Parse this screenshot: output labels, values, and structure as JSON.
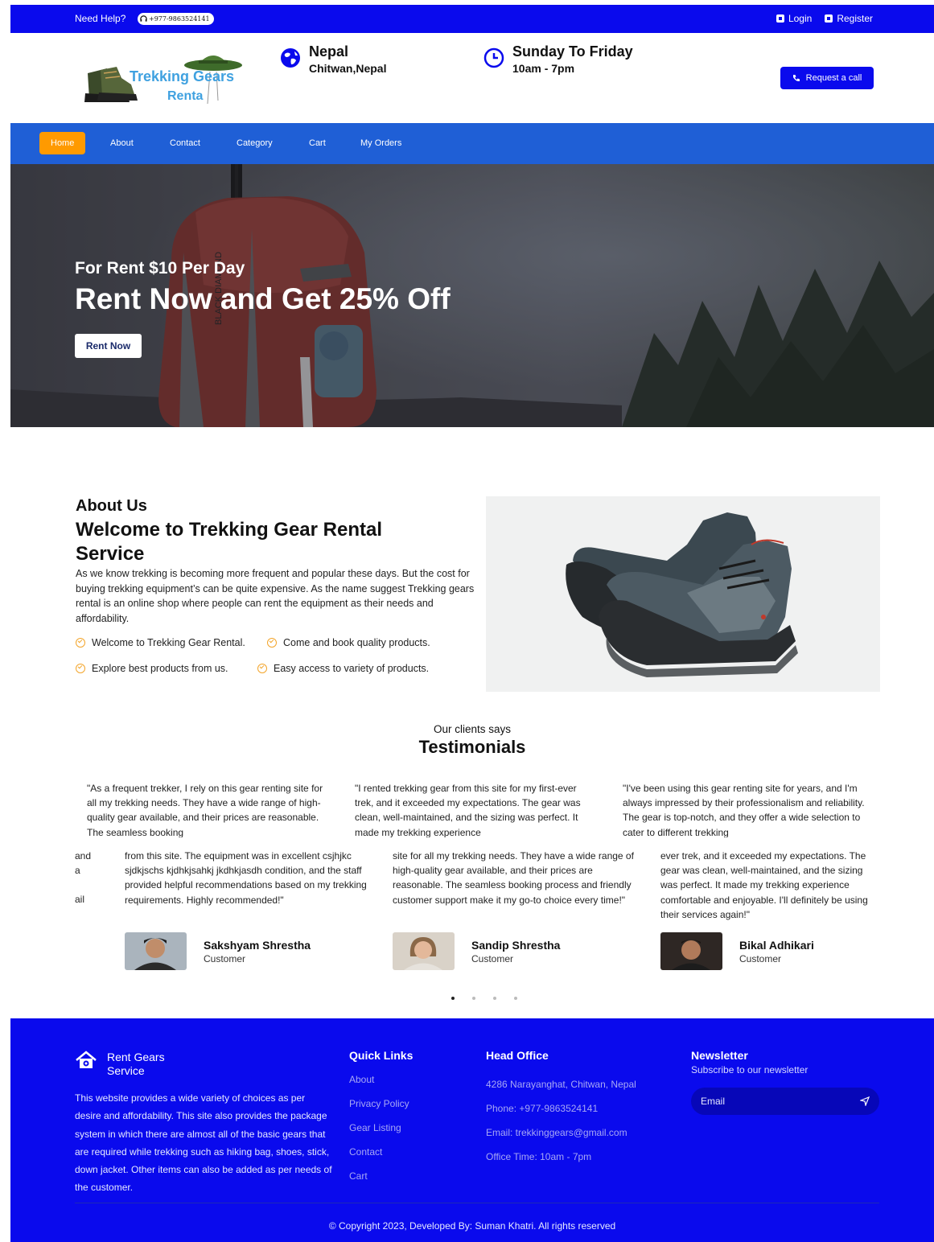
{
  "topbar": {
    "help_label": "Need Help?",
    "phone": "+977-9863524141",
    "login_label": "Login",
    "register_label": "Register"
  },
  "header": {
    "logo_line1": "Trekking Gears",
    "logo_line2": "Renta",
    "location_title": "Nepal",
    "location_sub": "Chitwan,Nepal",
    "hours_title": "Sunday To Friday",
    "hours_sub": "10am - 7pm",
    "request_call_label": "Request a call",
    "icons": [
      "globe-icon",
      "clock-icon",
      "phone-icon"
    ]
  },
  "nav": {
    "items": [
      {
        "label": "Home",
        "active": true
      },
      {
        "label": "About"
      },
      {
        "label": "Contact"
      },
      {
        "label": "Category"
      },
      {
        "label": "Cart"
      },
      {
        "label": "My Orders"
      }
    ]
  },
  "hero": {
    "subtitle": "For Rent $10 Per Day",
    "title": "Rent Now and Get 25% Off",
    "button_label": "Rent Now"
  },
  "about": {
    "label": "About Us",
    "title": "Welcome to Trekking Gear Rental Service",
    "text": "As we know trekking is becoming more frequent and popular these days. But the cost for buying trekking equipment’s can be quite expensive. As the name suggest Trekking gears rental is an online shop where people can rent the equipment as their needs and affordability.",
    "checks": [
      "Welcome to Trekking Gear Rental.",
      "Come and book quality products.",
      "Explore best products from us.",
      "Easy access to variety of products."
    ]
  },
  "testimonials": {
    "label": "Our clients says",
    "title": "Testimonials",
    "row1": [
      "\"As a frequent trekker, I rely on this gear renting site for all my trekking needs. They have a wide range of high-quality gear available, and their prices are reasonable. The seamless booking",
      "\"I rented trekking gear from this site for my first-ever trek, and it exceeded my expectations. The gear was clean, well-maintained, and the sizing was perfect. It made my trekking experience",
      "\"I've been using this gear renting site for years, and I'm always impressed by their professionalism and reliability. The gear is top-notch, and they offer a wide selection to cater to different trekking"
    ],
    "edge_fragments": [
      "and",
      "a",
      "ail"
    ],
    "row2": [
      "from this site. The equipment was in excellent csjhjkc sjdkjschs kjdhkjsahkj jkdhkjasdh condition, and the staff provided helpful recommendations based on my trekking requirements. Highly recommended!\"",
      "site for all my trekking needs. They have a wide range of high-quality gear available, and their prices are reasonable. The seamless booking process and friendly customer support make it my go-to choice every time!\"",
      "ever trek, and it exceeded my expectations. The gear was clean, well-maintained, and the sizing was perfect. It made my trekking experience comfortable and enjoyable. I'll definitely be using their services again!\""
    ],
    "people": [
      {
        "name": "Sakshyam Shrestha",
        "role": "Customer"
      },
      {
        "name": "Sandip Shrestha",
        "role": "Customer"
      },
      {
        "name": "Bikal Adhikari",
        "role": "Customer"
      }
    ]
  },
  "footer": {
    "brand_line1": "Rent Gears",
    "brand_line2": "Service",
    "description": "This website provides a wide variety of choices as per desire and affordability. This site also provides the package system in which there are almost all of the basic gears that are required while trekking such as hiking bag, shoes, stick, down jacket. Other items can also be added as per needs of the customer.",
    "quick_links_title": "Quick Links",
    "quick_links": [
      "About",
      "Privacy Policy",
      "Gear Listing",
      "Contact",
      "Cart"
    ],
    "office_title": "Head Office",
    "office": [
      "4286 Narayanghat, Chitwan, Nepal",
      "Phone: +977-9863524141",
      "Email: trekkinggears@gmail.com",
      "Office Time: 10am - 7pm"
    ],
    "newsletter_title": "Newsletter",
    "newsletter_sub": "Subscribe to our newsletter",
    "email_placeholder": "Email",
    "copyright": "© Copyright 2023, Developed By: Suman Khatri. All rights reserved"
  },
  "colors": {
    "topbar": "#0a0aed",
    "nav": "#1f5fd6",
    "nav_active": "#ff9a00",
    "footer": "#0a0aed",
    "check": "#f3a52b"
  }
}
